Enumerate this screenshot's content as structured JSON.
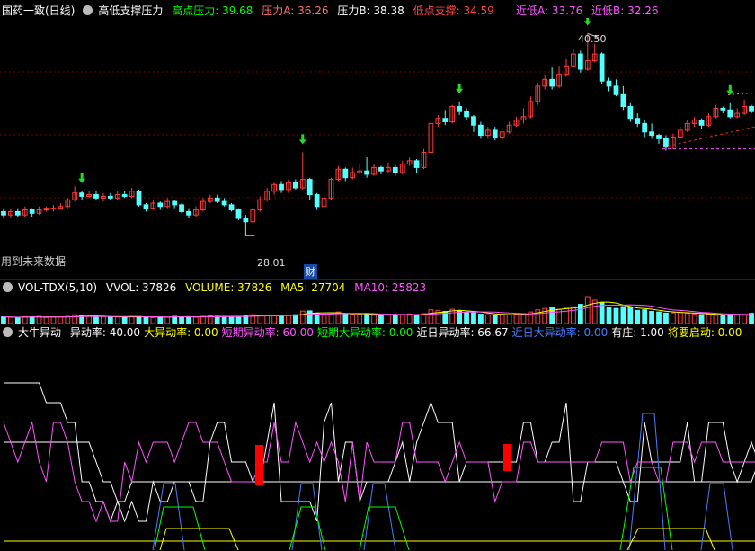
{
  "colors": {
    "up": "#ff3c3c",
    "down": "#54ffff",
    "white": "#ffffff",
    "yellow": "#ffff00",
    "magenta": "#ff55ff",
    "green": "#00ff00",
    "blue": "#4a7dff",
    "red": "#ff0000",
    "grid": "#7a0000"
  },
  "main": {
    "stock": "国药一致(日线)",
    "indicator": "高低支撑压力",
    "items": [
      {
        "label": "高点压力: 39.68",
        "color": "#00ff00"
      },
      {
        "label": "压力A: 36.26",
        "color": "#ff7070"
      },
      {
        "label": "压力B: 38.38",
        "color": "#ffffff"
      },
      {
        "label": "低点支撑: 34.59",
        "color": "#ff4444"
      }
    ],
    "items_right": [
      {
        "label": "近低A: 33.76",
        "color": "#ff55ff"
      },
      {
        "label": "近低B: 32.26",
        "color": "#ff55ff"
      }
    ],
    "high_label": "40.50",
    "low_label": "28.01",
    "note": "用到未来数据",
    "badge": "财"
  },
  "vol": {
    "indicator": "VOL-TDX(5,10)",
    "items": [
      {
        "label": "VVOL: 37826",
        "color": "#ffffff"
      },
      {
        "label": "VOLUME: 37826",
        "color": "#ffff00"
      },
      {
        "label": "MA5: 27704",
        "color": "#ffff00"
      },
      {
        "label": "MA10: 25823",
        "color": "#ff55ff"
      }
    ]
  },
  "osc": {
    "indicator": "大牛异动",
    "items": [
      {
        "label": "异动率: 40.00",
        "color": "#ffffff"
      },
      {
        "label": "大异动率: 0.00",
        "color": "#ffff00"
      },
      {
        "label": "短期异动率: 60.00",
        "color": "#ff55ff"
      },
      {
        "label": "短期大异动率: 0.00",
        "color": "#00ff00"
      },
      {
        "label": "近日异动率: 66.67",
        "color": "#ffffff"
      },
      {
        "label": "近日大异动率: 0.00",
        "color": "#4a7dff"
      },
      {
        "label": "有庄: 1.00",
        "color": "#ffffff"
      },
      {
        "label": "将要启动: 0.00",
        "color": "#ffff00"
      }
    ]
  },
  "chart_data": {
    "type": "candlestick",
    "ylim": [
      27,
      41
    ],
    "candles": [
      [
        30.0,
        29.8,
        30.2,
        29.6
      ],
      [
        29.8,
        30.0,
        30.2,
        29.6
      ],
      [
        30.0,
        29.8,
        30.2,
        29.7
      ],
      [
        29.8,
        30.1,
        30.3,
        29.7
      ],
      [
        30.1,
        29.9,
        30.2,
        29.7
      ],
      [
        29.9,
        30.1,
        30.3,
        29.8
      ],
      [
        30.1,
        30.2,
        30.3,
        30.0
      ],
      [
        30.2,
        30.2,
        30.4,
        30.0
      ],
      [
        30.2,
        30.3,
        30.5,
        30.1
      ],
      [
        30.3,
        30.7,
        30.8,
        30.2
      ],
      [
        30.7,
        31.1,
        31.5,
        30.6
      ],
      [
        31.1,
        30.9,
        31.2,
        30.7
      ],
      [
        30.9,
        31.0,
        31.2,
        30.8
      ],
      [
        31.0,
        30.8,
        31.2,
        30.7
      ],
      [
        30.8,
        30.9,
        31.1,
        30.6
      ],
      [
        30.9,
        30.8,
        31.1,
        30.7
      ],
      [
        30.8,
        31.0,
        31.2,
        30.7
      ],
      [
        31.0,
        30.9,
        31.2,
        30.8
      ],
      [
        30.9,
        31.2,
        31.4,
        30.8
      ],
      [
        31.2,
        30.4,
        31.3,
        30.3
      ],
      [
        30.4,
        30.2,
        30.5,
        30.0
      ],
      [
        30.2,
        30.5,
        30.7,
        30.1
      ],
      [
        30.5,
        30.3,
        30.6,
        30.1
      ],
      [
        30.3,
        30.6,
        30.8,
        30.2
      ],
      [
        30.6,
        30.4,
        30.7,
        30.2
      ],
      [
        30.4,
        30.0,
        30.5,
        29.9
      ],
      [
        30.0,
        29.8,
        30.2,
        29.6
      ],
      [
        29.8,
        30.1,
        30.3,
        29.7
      ],
      [
        30.1,
        30.6,
        30.8,
        30.0
      ],
      [
        30.6,
        30.8,
        31.0,
        30.5
      ],
      [
        30.8,
        30.6,
        31.0,
        30.5
      ],
      [
        30.6,
        30.4,
        30.8,
        30.3
      ],
      [
        30.4,
        30.1,
        30.5,
        30.0
      ],
      [
        30.1,
        29.6,
        30.2,
        29.5
      ],
      [
        29.6,
        29.4,
        29.8,
        28.6
      ],
      [
        29.4,
        30.1,
        30.2,
        29.3
      ],
      [
        30.1,
        30.7,
        30.9,
        30.0
      ],
      [
        30.7,
        31.2,
        31.4,
        30.6
      ],
      [
        31.2,
        31.6,
        31.7,
        31.0
      ],
      [
        31.6,
        31.3,
        31.8,
        31.1
      ],
      [
        31.3,
        31.7,
        31.9,
        31.1
      ],
      [
        31.7,
        31.4,
        31.9,
        31.3
      ],
      [
        31.4,
        31.9,
        33.5,
        31.3
      ],
      [
        31.9,
        31.0,
        32.0,
        30.7
      ],
      [
        31.0,
        30.3,
        31.1,
        30.1
      ],
      [
        30.3,
        30.8,
        31.0,
        30.0
      ],
      [
        30.8,
        31.9,
        32.0,
        30.7
      ],
      [
        31.9,
        32.5,
        32.7,
        31.8
      ],
      [
        32.5,
        32.0,
        32.6,
        31.8
      ],
      [
        32.0,
        32.3,
        32.6,
        31.9
      ],
      [
        32.3,
        32.4,
        32.8,
        32.2
      ],
      [
        32.4,
        32.2,
        33.2,
        32.0
      ],
      [
        32.2,
        32.6,
        32.8,
        32.1
      ],
      [
        32.6,
        32.4,
        32.7,
        32.2
      ],
      [
        32.4,
        32.6,
        32.9,
        32.3
      ],
      [
        32.6,
        32.3,
        32.8,
        32.1
      ],
      [
        32.3,
        32.8,
        33.0,
        32.2
      ],
      [
        32.8,
        33.0,
        33.2,
        32.7
      ],
      [
        33.0,
        32.6,
        33.1,
        32.3
      ],
      [
        32.6,
        33.5,
        33.7,
        32.5
      ],
      [
        33.5,
        35.2,
        35.4,
        33.4
      ],
      [
        35.2,
        35.5,
        35.7,
        35.0
      ],
      [
        35.5,
        35.3,
        36.0,
        35.1
      ],
      [
        35.3,
        36.2,
        36.3,
        35.2
      ],
      [
        36.2,
        35.9,
        36.5,
        35.7
      ],
      [
        35.9,
        35.6,
        36.1,
        35.4
      ],
      [
        35.6,
        35.1,
        35.7,
        34.7
      ],
      [
        35.1,
        34.5,
        35.3,
        34.3
      ],
      [
        34.5,
        34.8,
        35.0,
        34.3
      ],
      [
        34.8,
        34.4,
        35.0,
        34.2
      ],
      [
        34.4,
        34.7,
        34.9,
        34.2
      ],
      [
        34.7,
        35.1,
        35.3,
        34.6
      ],
      [
        35.1,
        35.4,
        35.6,
        35.0
      ],
      [
        35.4,
        35.6,
        36.1,
        35.2
      ],
      [
        35.6,
        36.5,
        36.8,
        35.5
      ],
      [
        36.5,
        37.4,
        37.6,
        36.3
      ],
      [
        37.4,
        37.8,
        38.1,
        37.2
      ],
      [
        37.8,
        37.4,
        38.5,
        37.2
      ],
      [
        37.4,
        38.1,
        38.6,
        37.3
      ],
      [
        38.1,
        38.6,
        39.0,
        38.0
      ],
      [
        38.6,
        39.3,
        39.6,
        38.5
      ],
      [
        39.3,
        38.4,
        39.5,
        38.2
      ],
      [
        38.4,
        38.9,
        40.5,
        38.3
      ],
      [
        38.9,
        39.3,
        39.9,
        38.8
      ],
      [
        39.3,
        37.7,
        39.4,
        37.5
      ],
      [
        37.7,
        37.4,
        37.9,
        37.1
      ],
      [
        37.4,
        36.9,
        37.8,
        36.8
      ],
      [
        36.9,
        36.2,
        37.4,
        36.0
      ],
      [
        36.2,
        35.5,
        36.4,
        35.3
      ],
      [
        35.5,
        35.2,
        35.8,
        35.0
      ],
      [
        35.2,
        34.7,
        35.4,
        34.4
      ],
      [
        34.7,
        34.5,
        35.2,
        34.3
      ],
      [
        34.5,
        34.3,
        34.6,
        34.0
      ],
      [
        34.3,
        33.8,
        34.5,
        33.6
      ],
      [
        33.8,
        34.4,
        34.6,
        33.7
      ],
      [
        34.4,
        34.8,
        35.0,
        34.3
      ],
      [
        34.8,
        35.2,
        35.4,
        34.7
      ],
      [
        35.2,
        35.4,
        35.6,
        35.0
      ],
      [
        35.4,
        35.1,
        35.5,
        34.9
      ],
      [
        35.1,
        35.6,
        35.8,
        35.0
      ],
      [
        35.6,
        36.1,
        36.3,
        35.5
      ],
      [
        36.1,
        36.0,
        36.2,
        35.8
      ],
      [
        36.0,
        35.6,
        36.4,
        35.5
      ],
      [
        35.6,
        35.8,
        36.1,
        35.5
      ],
      [
        35.8,
        36.2,
        36.6,
        35.7
      ],
      [
        36.2,
        35.9,
        36.3,
        35.8
      ]
    ],
    "volume": [
      2.4,
      2.3,
      2.2,
      2.5,
      2.4,
      2.6,
      2.2,
      2.3,
      2.4,
      2.6,
      3.2,
      2.8,
      2.6,
      2.4,
      2.5,
      2.3,
      2.4,
      2.3,
      2.6,
      2.5,
      2.3,
      2.2,
      2.4,
      2.3,
      2.6,
      2.4,
      2.5,
      2.3,
      2.6,
      2.8,
      2.6,
      2.5,
      2.4,
      2.6,
      3.0,
      3.2,
      2.9,
      3.0,
      2.8,
      3.1,
      3.0,
      3.2,
      4.5,
      4.6,
      3.8,
      3.2,
      3.5,
      4.2,
      3.6,
      3.3,
      3.2,
      3.4,
      3.0,
      3.2,
      3.1,
      2.9,
      3.3,
      3.5,
      3.2,
      3.6,
      5.0,
      4.8,
      4.4,
      5.2,
      4.6,
      4.0,
      3.9,
      3.4,
      3.2,
      3.0,
      3.3,
      3.2,
      3.5,
      3.6,
      4.2,
      5.0,
      5.5,
      5.8,
      5.2,
      5.6,
      6.1,
      7.0,
      9.8,
      8.5,
      7.6,
      6.0,
      5.5,
      6.2,
      5.8,
      4.8,
      5.0,
      4.4,
      4.2,
      3.8,
      3.9,
      4.0,
      3.7,
      3.5,
      3.2,
      3.4,
      3.0,
      2.8,
      3.2,
      3.1,
      3.3,
      3.7
    ],
    "osc_series": [
      {
        "values": [
          8,
          8,
          8,
          8,
          8,
          8,
          7,
          7,
          7,
          6,
          6,
          3,
          3,
          2,
          2,
          1,
          2,
          1,
          2,
          1,
          1,
          3,
          2,
          2,
          3,
          3,
          3,
          2,
          2,
          5,
          6,
          6,
          4,
          4,
          4,
          3,
          3,
          5,
          7,
          2,
          2,
          2,
          2,
          2,
          1,
          6,
          7,
          3,
          5,
          5,
          2,
          3,
          3,
          3,
          3,
          4,
          5,
          3,
          5,
          6,
          7,
          6,
          6,
          6,
          3,
          4,
          4,
          4,
          4,
          4,
          4,
          4,
          4,
          6,
          6,
          4,
          4,
          5,
          5,
          7,
          2,
          2,
          4,
          4,
          4,
          4,
          4,
          3,
          2,
          2,
          6,
          4,
          4,
          4,
          4,
          4,
          6,
          3,
          3,
          6,
          6,
          6,
          4,
          3,
          4,
          5,
          4
        ],
        "color": "#ffffff"
      },
      {
        "values": [
          5,
          5,
          5,
          5,
          5,
          5,
          5,
          5,
          5,
          5,
          5,
          5,
          5,
          4,
          3,
          3,
          2,
          2,
          3,
          3,
          3,
          3,
          3,
          3,
          3,
          3,
          3,
          3,
          3,
          3,
          3,
          3,
          3,
          3,
          3,
          3,
          3,
          3,
          3,
          3,
          3,
          3,
          3,
          3,
          3,
          3,
          3,
          3,
          3,
          3,
          3,
          3,
          3,
          3,
          3,
          3,
          3,
          3,
          3,
          3,
          3,
          3,
          3,
          3,
          3,
          3,
          3,
          3,
          3,
          3,
          3,
          3,
          3,
          3,
          3,
          3,
          3,
          3,
          3,
          3,
          3,
          3,
          3,
          3,
          3,
          3,
          3,
          3,
          3,
          3,
          3,
          3,
          3,
          3,
          3,
          3,
          3,
          3,
          3,
          3,
          3,
          3,
          3,
          3,
          3,
          3,
          4
        ],
        "color": "#ffffff"
      },
      {
        "values": [
          6,
          5,
          4,
          5,
          6,
          4,
          3,
          6,
          6,
          5,
          3,
          2,
          2,
          1,
          2,
          1,
          1,
          4,
          3,
          5,
          4,
          5,
          5,
          5,
          4,
          5,
          6,
          6,
          5,
          5,
          5,
          4,
          3,
          3,
          3,
          3,
          4,
          4,
          6,
          4,
          4,
          6,
          5,
          4,
          5,
          4,
          5,
          4,
          2,
          5,
          2,
          5,
          4,
          4,
          4,
          4,
          6,
          6,
          4,
          4,
          4,
          4,
          3,
          4,
          5,
          4,
          4,
          4,
          4,
          2,
          3,
          3,
          3,
          5,
          5,
          4,
          4,
          4,
          4,
          4,
          4,
          4,
          4,
          4,
          5,
          5,
          5,
          5,
          3,
          4,
          4,
          4,
          3,
          3,
          5,
          5,
          5,
          4,
          5,
          5,
          5,
          4,
          4,
          4,
          4,
          4,
          4
        ],
        "color": "#ff55ff"
      },
      {
        "values": [
          0,
          0,
          0,
          0,
          0,
          0,
          0,
          0,
          0,
          0,
          0,
          0,
          0,
          0,
          0,
          0,
          0,
          0,
          0,
          0,
          0,
          0,
          0,
          0,
          0,
          0,
          0,
          0,
          0,
          0,
          0,
          0,
          0,
          0,
          0,
          0,
          0,
          0,
          0,
          0,
          0,
          0,
          0,
          0,
          0,
          0,
          0,
          0,
          0,
          0,
          0,
          0,
          0,
          0,
          0,
          0,
          0,
          0,
          0,
          0,
          0,
          0,
          0,
          0,
          0,
          0,
          0,
          0,
          0,
          0,
          0,
          0,
          0,
          0,
          0,
          0,
          0,
          0,
          0,
          0,
          0,
          0,
          0,
          0,
          0,
          0,
          0,
          0,
          0,
          0,
          0,
          0,
          0,
          0,
          0,
          0,
          0,
          0,
          0,
          0,
          0,
          0,
          0,
          0,
          0,
          0,
          0
        ],
        "color": "#ffff00"
      }
    ]
  }
}
